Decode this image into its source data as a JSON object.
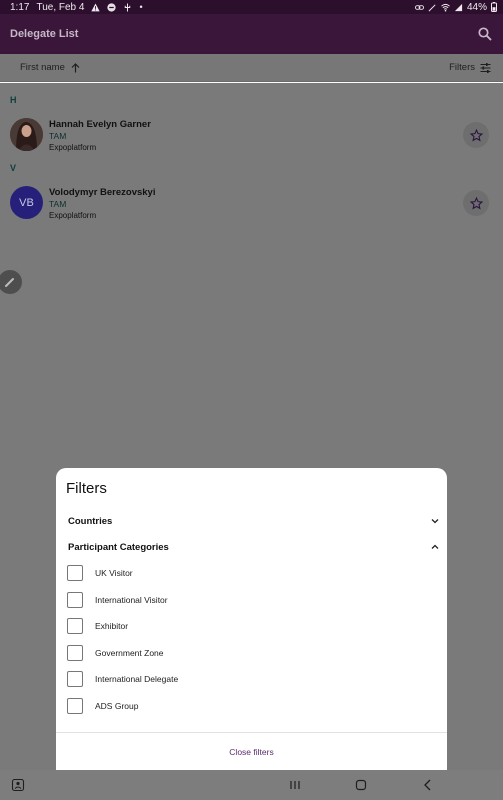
{
  "status_bar": {
    "time": "1:17",
    "date": "Tue, Feb 4",
    "battery": "44%"
  },
  "app_bar": {
    "title": "Delegate List"
  },
  "sort_bar": {
    "sort_label": "First name",
    "filters_label": "Filters"
  },
  "delegates": [
    {
      "letter": "H",
      "name": "Hannah Evelyn Garner",
      "role": "TAM",
      "org": "Expoplatform",
      "avatar_type": "photo"
    },
    {
      "letter": "V",
      "name": "Volodymyr Berezovskyi",
      "role": "TAM",
      "org": "Expoplatform",
      "initials": "VB",
      "avatar_type": "initials"
    }
  ],
  "filters_sheet": {
    "title": "Filters",
    "sections": [
      {
        "label": "Countries",
        "expanded": false
      },
      {
        "label": "Participant Categories",
        "expanded": true
      }
    ],
    "options": [
      "UK Visitor",
      "International Visitor",
      "Exhibitor",
      "Government Zone",
      "International Delegate",
      "ADS Group"
    ],
    "close_label": "Close filters"
  },
  "colors": {
    "accent": "#3a173a",
    "link": "#5a2a6e",
    "avatar_bg": "#26207a"
  }
}
